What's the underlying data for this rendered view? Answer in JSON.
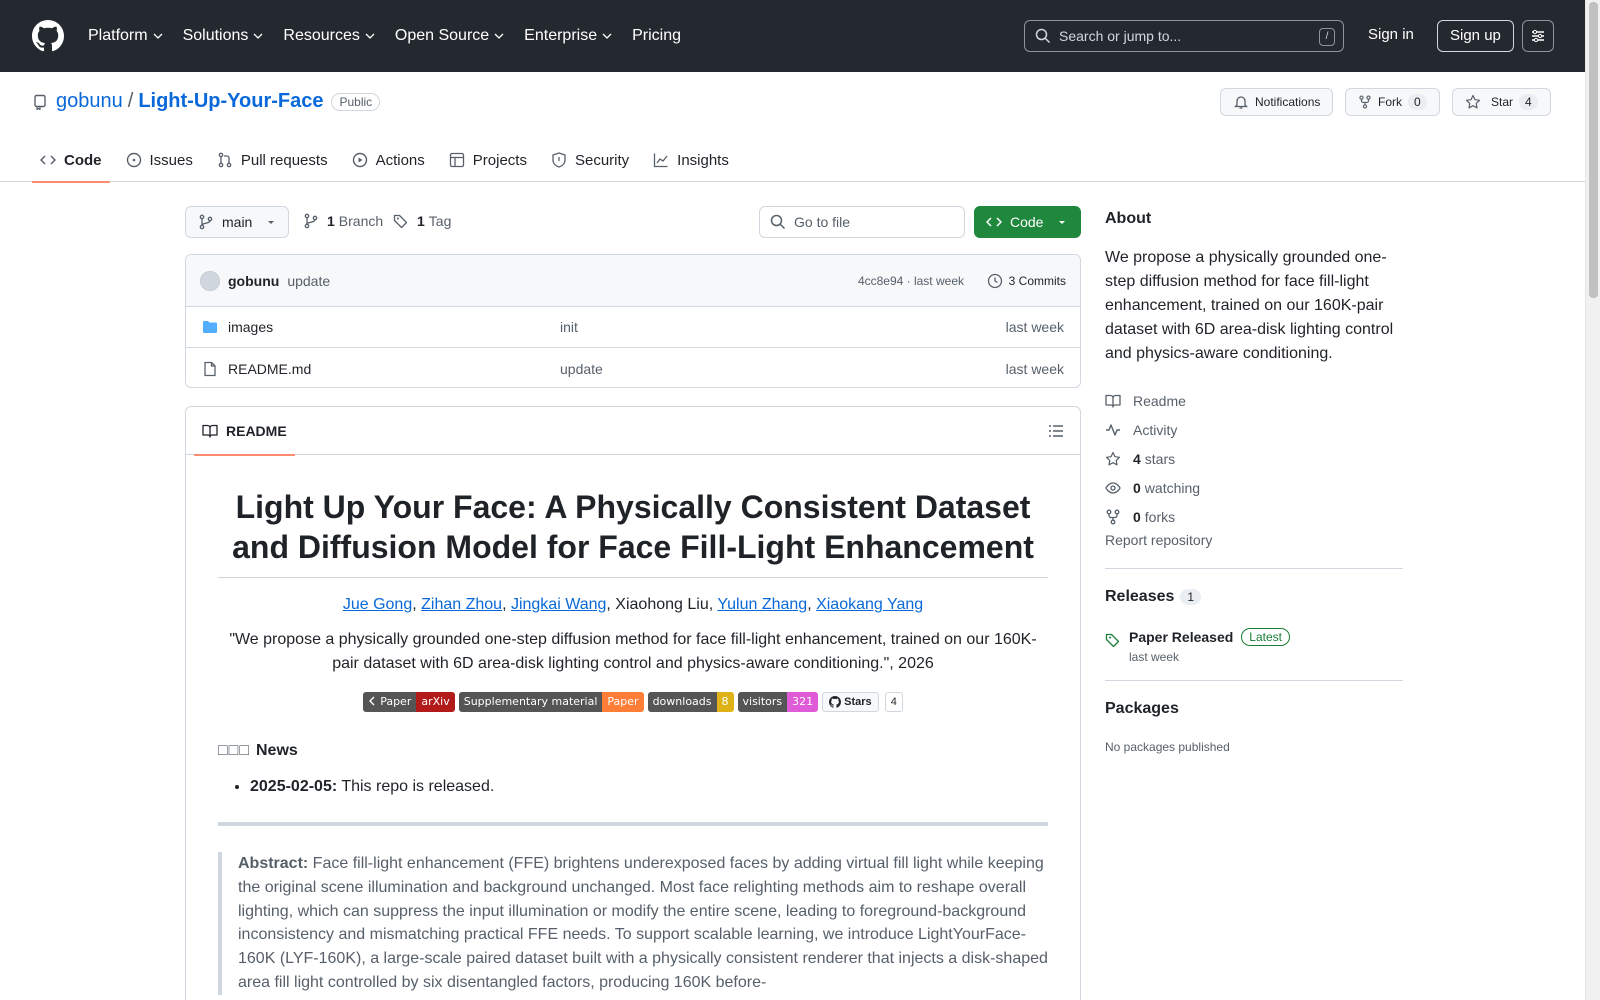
{
  "header": {
    "nav": [
      "Platform",
      "Solutions",
      "Resources",
      "Open Source",
      "Enterprise",
      "Pricing"
    ],
    "search_placeholder": "Search or jump to...",
    "search_shortcut": "/",
    "signin": "Sign in",
    "signup": "Sign up"
  },
  "repo": {
    "owner": "gobunu",
    "separator": "/",
    "name": "Light-Up-Your-Face",
    "visibility": "Public",
    "notifications_label": "Notifications",
    "fork_label": "Fork",
    "fork_count": "0",
    "star_label": "Star",
    "star_count": "4",
    "tabs": [
      "Code",
      "Issues",
      "Pull requests",
      "Actions",
      "Projects",
      "Security",
      "Insights"
    ]
  },
  "toolbar": {
    "branch": "main",
    "branch_count": "1",
    "branch_label": "Branch",
    "tag_count": "1",
    "tag_label": "Tag",
    "goto_placeholder": "Go to file",
    "code_button": "Code"
  },
  "commit": {
    "author": "gobunu",
    "message": "update",
    "hash_time": "4cc8e94 · last week",
    "commits_label": "3 Commits"
  },
  "files": [
    {
      "name": "images",
      "message": "init",
      "date": "last week",
      "type": "folder"
    },
    {
      "name": "README.md",
      "message": "update",
      "date": "last week",
      "type": "file"
    }
  ],
  "readme": {
    "tab_label": "README",
    "title": "Light Up Your Face: A Physically Consistent Dataset and Diffusion Model for Face Fill-Light Enhancement",
    "authors": [
      "Jue Gong",
      "Zihan Zhou",
      "Jingkai Wang",
      "Xiaohong Liu",
      "Yulun Zhang",
      "Xiaokang Yang"
    ],
    "linked_authors": [
      true,
      true,
      true,
      false,
      true,
      true
    ],
    "author_separator": ", ",
    "quote": "\"We propose a physically grounded one-step diffusion method for face fill-light enhancement, trained on our 160K-pair dataset with 6D area-disk lighting control and physics-aware conditioning.\", 2026",
    "badges": [
      {
        "left": "Paper",
        "right": "arXiv",
        "color": "#b31b1b"
      },
      {
        "left": "Supplementary material",
        "right": "Paper",
        "color": "#fe7d37"
      },
      {
        "left": "downloads",
        "right": "8",
        "color": "#dfb317"
      },
      {
        "left": "visitors",
        "right": "321",
        "color": "#e05bd7"
      }
    ],
    "gh_stars_label": "Stars",
    "gh_stars_count": "4",
    "news_boxes": "□□□",
    "news_title": "News",
    "news_items": [
      {
        "date": "2025-02-05:",
        "text": " This repo is released."
      }
    ],
    "abstract_label": "Abstract:",
    "abstract_text": " Face fill-light enhancement (FFE) brightens underexposed faces by adding virtual fill light while keeping the original scene illumination and background unchanged. Most face relighting methods aim to reshape overall lighting, which can suppress the input illumination or modify the entire scene, leading to foreground-background inconsistency and mismatching practical FFE needs. To support scalable learning, we introduce LightYourFace-160K (LYF-160K), a large-scale paired dataset built with a physically consistent renderer that injects a disk-shaped area fill light controlled by six disentangled factors, producing 160K before-"
  },
  "sidebar": {
    "about_title": "About",
    "description": "We propose a physically grounded one-step diffusion method for face fill-light enhancement, trained on our 160K-pair dataset with 6D area-disk lighting control and physics-aware conditioning.",
    "readme": "Readme",
    "activity": "Activity",
    "stars_count": "4",
    "stars_label": "stars",
    "watching_count": "0",
    "watching_label": "watching",
    "forks_count": "0",
    "forks_label": "forks",
    "report": "Report repository",
    "releases_title": "Releases",
    "releases_count": "1",
    "release_name": "Paper Released",
    "release_badge": "Latest",
    "release_date": "last week",
    "packages_title": "Packages",
    "no_packages": "No packages published"
  },
  "colors": {
    "header_bg": "#24292f",
    "link": "#0969da",
    "code_button": "#1f883d",
    "tab_underline": "#fd8c73"
  }
}
